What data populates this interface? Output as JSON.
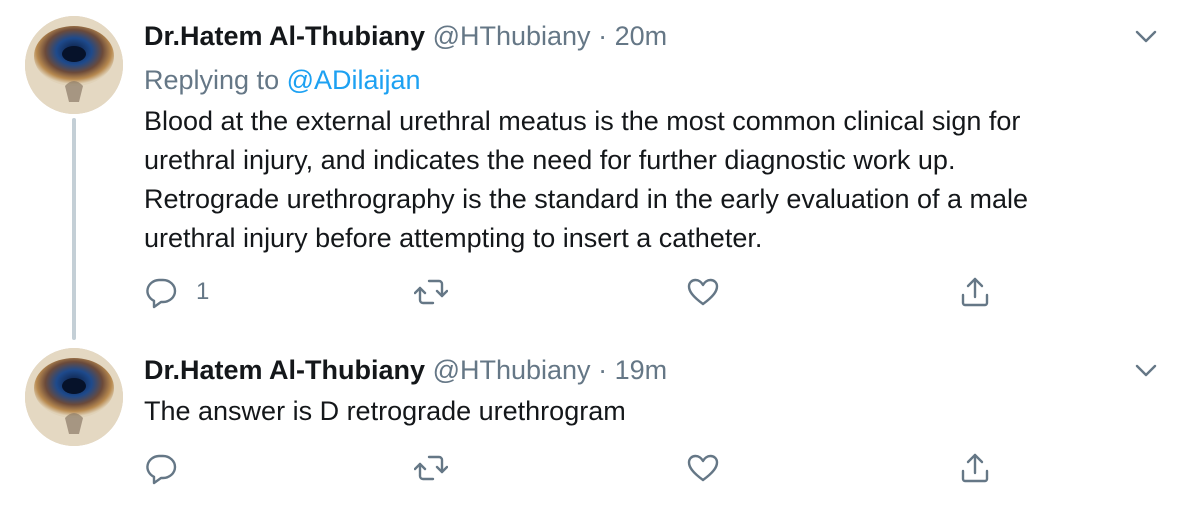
{
  "tweets": [
    {
      "author_name": "Dr.Hatem Al-Thubiany",
      "handle": "@HThubiany",
      "separator": "·",
      "time": "20m",
      "replying_prefix": "Replying to",
      "replying_to": "@ADilaijan",
      "lines": [
        "Blood at the external urethral meatus is the most common clinical sign for",
        "urethral injury, and indicates the need for further diagnostic work up.",
        "Retrograde urethrography is the standard in the early evaluation of a male",
        "urethral injury before attempting to insert a catheter."
      ],
      "reply_count": "1"
    },
    {
      "author_name": "Dr.Hatem Al-Thubiany",
      "handle": "@HThubiany",
      "separator": "·",
      "time": "19m",
      "lines": [
        "The answer is D retrograde urethrogram"
      ],
      "reply_count": ""
    }
  ],
  "icons": {
    "reply": "speech-bubble-icon",
    "retweet": "retweet-arrows-icon",
    "like": "heart-icon",
    "share": "share-upload-icon",
    "more": "chevron-down-icon"
  },
  "colors": {
    "text": "#14171a",
    "secondary": "#657786",
    "link": "#1da1f2",
    "thread_line": "#c4cfd6"
  }
}
